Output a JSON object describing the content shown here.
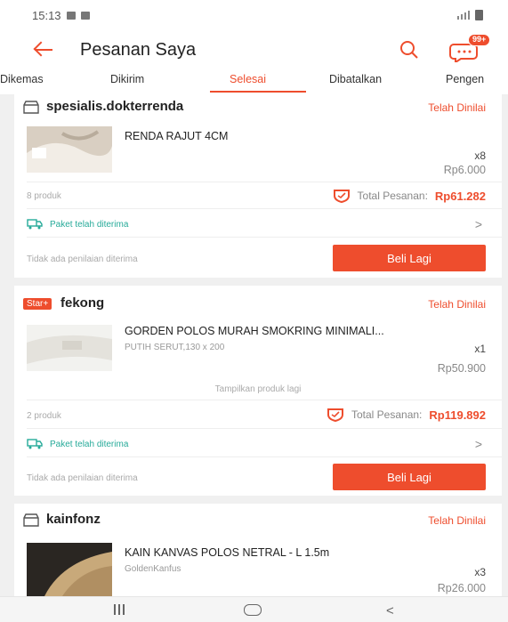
{
  "status_bar": {
    "time": "15:13"
  },
  "app_bar": {
    "title": "Pesanan Saya",
    "chat_badge": "99+"
  },
  "tabs": [
    {
      "label": "Dikemas",
      "active": false
    },
    {
      "label": "Dikirim",
      "active": false
    },
    {
      "label": "Selesai",
      "active": true
    },
    {
      "label": "Dibatalkan",
      "active": false
    },
    {
      "label": "Pengen",
      "active": false
    }
  ],
  "orders": [
    {
      "shop_name": "spesialis.dokterrenda",
      "shop_badge": "",
      "status": "Telah Dinilai",
      "product_name": "RENDA RAJUT 4CM",
      "variant": "",
      "quantity": "x8",
      "price": "Rp6.000",
      "product_count": "8 produk",
      "total_label": "Total Pesanan:",
      "total_amount": "Rp61.282",
      "shipping_status": "Paket telah diterima",
      "rating_note": "Tidak ada penilaian diterima",
      "buy_again_label": "Beli Lagi"
    },
    {
      "shop_name": "fekong",
      "shop_badge": "Star+",
      "status": "Telah Dinilai",
      "product_name": "GORDEN POLOS MURAH SMOKRING MINIMALI...",
      "variant": "PUTIH SERUT,130 x 200",
      "quantity": "x1",
      "price": "Rp50.900",
      "show_more": "Tampilkan produk lagi",
      "product_count": "2 produk",
      "total_label": "Total Pesanan:",
      "total_amount": "Rp119.892",
      "shipping_status": "Paket telah diterima",
      "rating_note": "Tidak ada penilaian diterima",
      "buy_again_label": "Beli Lagi"
    },
    {
      "shop_name": "kainfonz",
      "shop_badge": "",
      "status": "Telah Dinilai",
      "product_name": "KAIN KANVAS POLOS NETRAL - L 1.5m",
      "variant": "GoldenKanfus",
      "quantity": "x3",
      "price": "Rp26.000"
    }
  ],
  "colors": {
    "accent": "#ee4d2d",
    "shipping": "#26aa99"
  }
}
